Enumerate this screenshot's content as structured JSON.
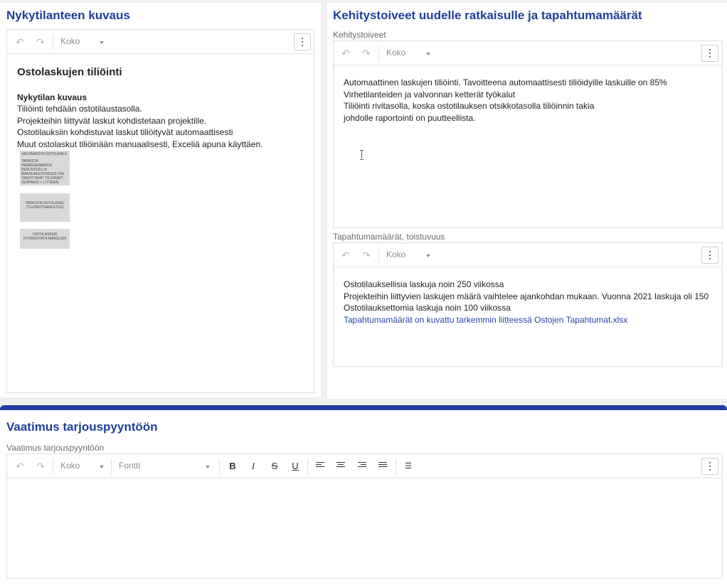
{
  "left_panel": {
    "title": "Nykytilanteen kuvaus",
    "editor": {
      "size_select": "Koko",
      "heading": "Ostolaskujen tiliöinti",
      "subheading": "Nykytilan kuvaus",
      "lines": [
        "Tiliöinti tehdään ostotilaustasolla.",
        "Projekteihin liittyvät laskut kohdistetaan projektille.",
        "Ostotilauksiin kohdistuvat laskut tiliöityvät automaattisesti",
        "Muut ostolaskut tiliöinään manuaalisesti, Exceliä apuna käyttäen."
      ],
      "flow_boxes": [
        "VASTAANOTA OSTOLASKU",
        "TARKISTA HANKENUMERON PERUSTEELLA MAKSUKELPOISUUS TEE TARVITTAVAT TILIÖINNIT (SOPIMUS + LITTERA)",
        "TARKISTA OSTOLASKU (TILIÖINTITARKISTUS)",
        "OSTOLASKUN HYVÄKSYNTÄ MAKSUUN"
      ]
    }
  },
  "right_panel": {
    "title": "Kehitystoiveet uudelle ratkaisulle ja tapahtumamäärät",
    "wishes": {
      "label": "Kehitystoiveet",
      "size_select": "Koko",
      "lines": [
        "Automaattinen laskujen tiliöinti. Tavoitteena automaattisesti tiliöidyille laskuille on 85%",
        "Virhetilanteiden ja valvonnan ketterät työkalut",
        "Tiliöinti rivitasolla, koska ostotilauksen otsikkotasolla tiliöinnin takia",
        "johdolle raportointi on puutteellista."
      ]
    },
    "volumes": {
      "label": "Tapahtumamäärät, toistuvuus",
      "size_select": "Koko",
      "lines": [
        "Ostotilauksellisia laskuja noin 250 viikossa",
        "Projekteihin liittyvien laskujen määrä vaihtelee ajankohdan mukaan. Vuonna 2021 laskuja oli 150",
        "Ostotilauksettomia laskuja noin 100 viikossa"
      ],
      "link_line": "Tapahtumamäärät on kuvattu tarkemmin liitteessä Ostojen Tapahtumat.xlsx"
    }
  },
  "bottom_panel": {
    "title": "Vaatimus tarjouspyyntöön",
    "field_label": "Vaatimus tarjouspyyntöön",
    "size_select": "Koko",
    "font_select": "Fontti",
    "bold": "B",
    "italic": "I",
    "strike": "S",
    "underline": "U"
  },
  "colors": {
    "title_blue": "#1e3f9c",
    "accent_bar": "#1f3fa3"
  }
}
